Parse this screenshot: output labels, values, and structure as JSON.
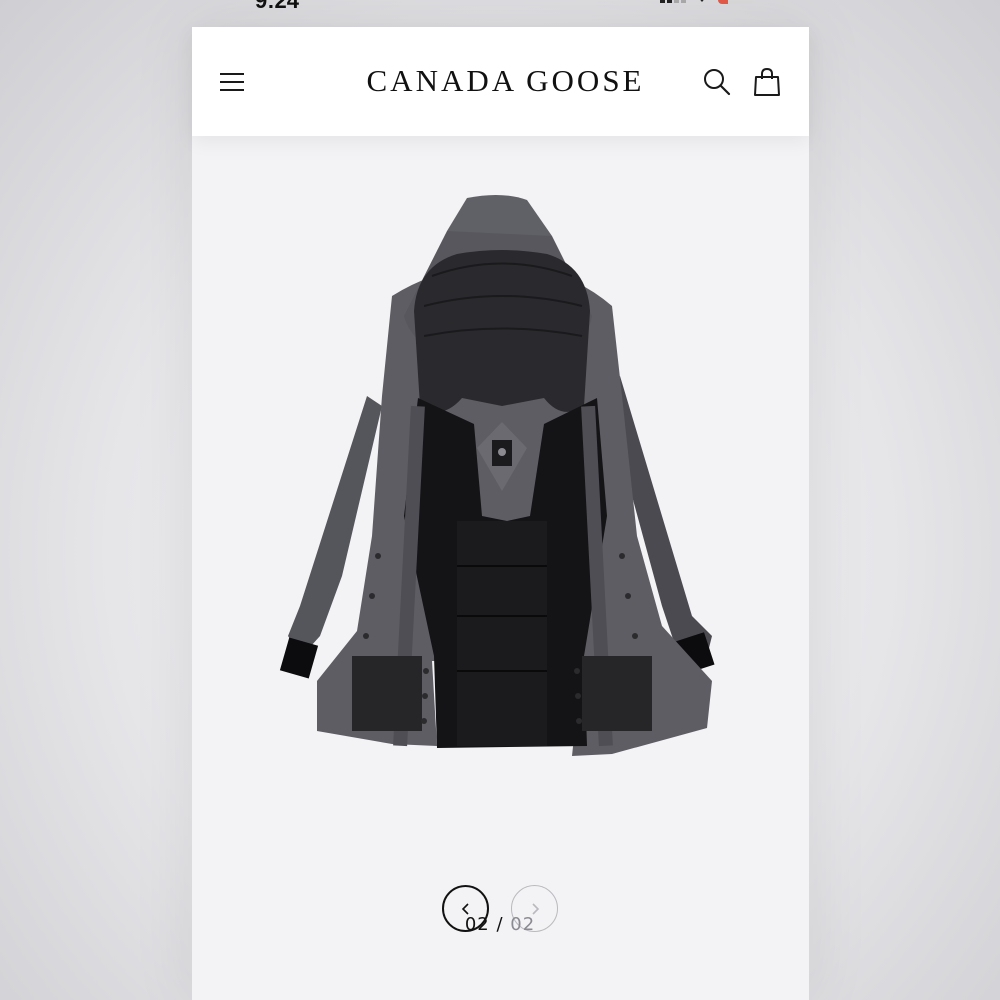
{
  "status_bar": {
    "time": "9:24"
  },
  "header": {
    "brand": "CANADA GOOSE",
    "menu_icon": "hamburger-menu-icon",
    "search_icon": "search-icon",
    "bag_icon": "shopping-bag-icon"
  },
  "product": {
    "image": "parka-interior-view"
  },
  "carousel": {
    "prev_icon": "chevron-left-icon",
    "next_icon": "chevron-right-icon",
    "current": "02",
    "separator": "/",
    "total": "02"
  }
}
